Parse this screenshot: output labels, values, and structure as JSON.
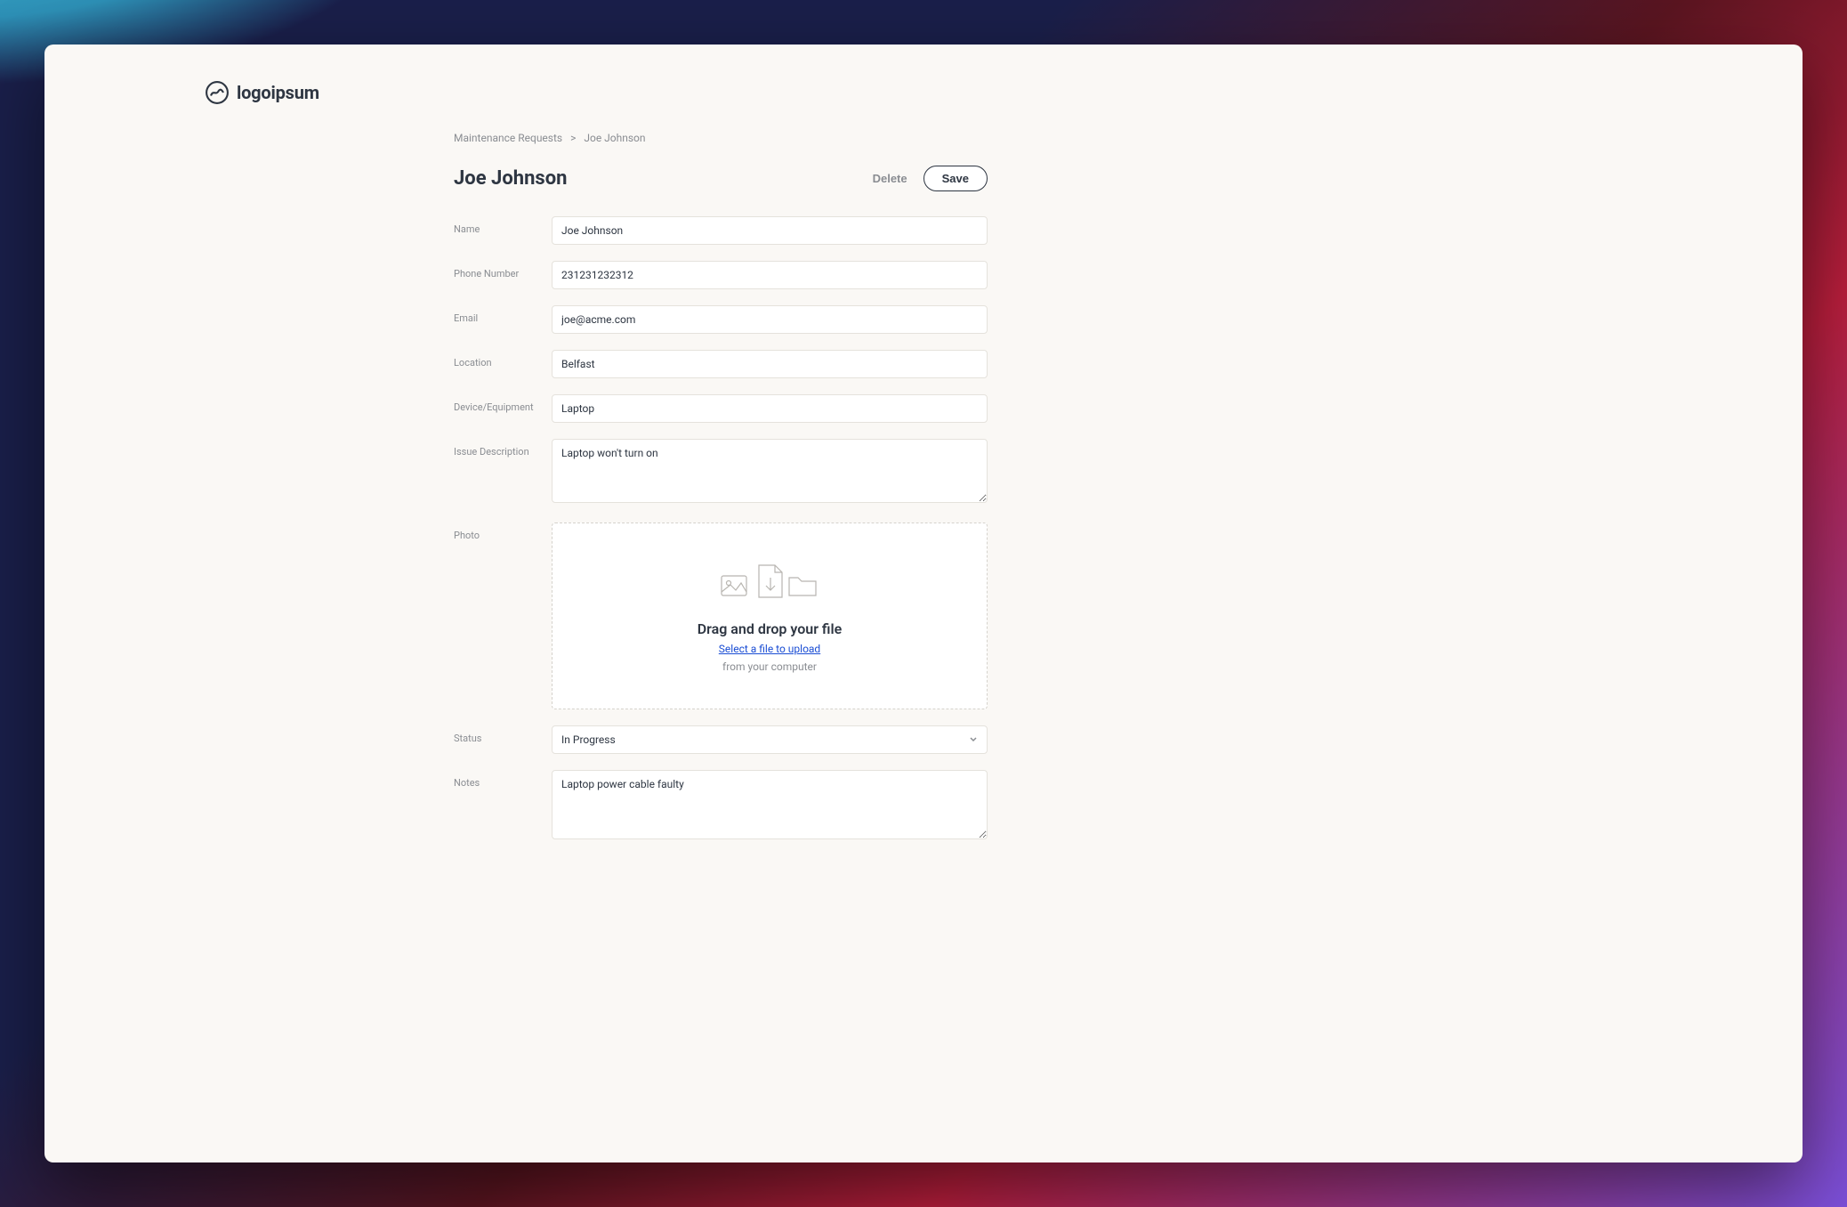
{
  "brand": {
    "name": "logoipsum"
  },
  "breadcrumb": {
    "parent": "Maintenance Requests",
    "separator": ">",
    "current": "Joe Johnson"
  },
  "header": {
    "title": "Joe Johnson",
    "delete_label": "Delete",
    "save_label": "Save"
  },
  "fields": {
    "name": {
      "label": "Name",
      "value": "Joe Johnson"
    },
    "phone": {
      "label": "Phone Number",
      "value": "231231232312"
    },
    "email": {
      "label": "Email",
      "value": "joe@acme.com"
    },
    "location": {
      "label": "Location",
      "value": "Belfast"
    },
    "device": {
      "label": "Device/Equipment",
      "value": "Laptop"
    },
    "issue": {
      "label": "Issue Description",
      "value": "Laptop won't turn on"
    },
    "photo": {
      "label": "Photo",
      "dz_title": "Drag and drop your file",
      "dz_link": "Select a file to upload",
      "dz_sub": "from your computer"
    },
    "status": {
      "label": "Status",
      "value": "In Progress"
    },
    "notes": {
      "label": "Notes",
      "value": "Laptop power cable faulty"
    }
  }
}
